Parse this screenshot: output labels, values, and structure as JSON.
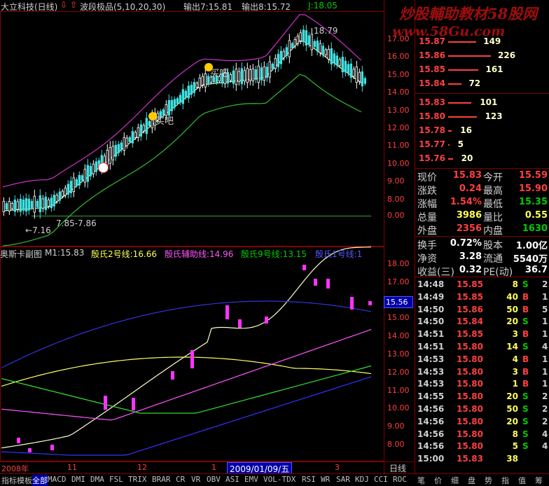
{
  "header": {
    "title": "大立科技(日线)",
    "arrow_label": "波段极品(5,10,20,30)",
    "out7": "输出7:15.81",
    "out8": "输出8:15.72",
    "jval": "J:18.05"
  },
  "watermark": {
    "brand": "炒股輔助教材58股网",
    "url": "www.58Gu.com"
  },
  "main_chart": {
    "price_ticks": [
      "17.00",
      "16.00",
      "15.00",
      "14.00",
      "13.00",
      "12.00",
      "11.00",
      "10.00",
      "9.00",
      "8.00"
    ],
    "annot_high": "18.79",
    "annot_low": "7.16",
    "annot_range": "7.85-7.86",
    "buy_label": "买吧",
    "zero_tick": "0.00"
  },
  "sub_chart": {
    "title": "奥斯卡副图",
    "m1": "M1:15.83",
    "l2": "殷氏2号线:16.66",
    "aux": "殷氏辅助线:14.96",
    "l9": "殷氏9号线:13.15",
    "l10": "殷氏1号线:1",
    "ticks": [
      "18.00",
      "17.00",
      "16.00",
      "15.00",
      "14.00",
      "13.00",
      "12.00",
      "11.00",
      "10.00",
      "9.00",
      "8.00"
    ],
    "current": "15.56"
  },
  "xaxis": {
    "labels": [
      "2008年",
      "11",
      "12",
      "1",
      "3"
    ],
    "date_box": "2009/01/09/五",
    "period": "日线"
  },
  "order_book": {
    "asks": [
      {
        "price": "15.87",
        "vol": "149"
      },
      {
        "price": "15.86",
        "vol": "226"
      },
      {
        "price": "15.85",
        "vol": "161"
      },
      {
        "price": "15.84",
        "vol": "72"
      }
    ],
    "bids": [
      {
        "price": "15.83",
        "vol": "101"
      },
      {
        "price": "15.80",
        "vol": "123"
      },
      {
        "price": "15.78",
        "vol": "16"
      },
      {
        "price": "15.77",
        "vol": "5"
      },
      {
        "price": "15.76",
        "vol": "20"
      }
    ]
  },
  "quote": {
    "rows": [
      {
        "l1": "现价",
        "v1": "15.83",
        "c1": "#ff4040",
        "l2": "今开",
        "v2": "15.59",
        "c2": "#ff4040"
      },
      {
        "l1": "涨跌",
        "v1": "0.24",
        "c1": "#ff4040",
        "l2": "最高",
        "v2": "15.90",
        "c2": "#ff4040"
      },
      {
        "l1": "涨幅",
        "v1": "1.54%",
        "c1": "#ff4040",
        "l2": "最低",
        "v2": "15.35",
        "c2": "#00cc00"
      },
      {
        "l1": "总量",
        "v1": "3986",
        "c1": "#ffff55",
        "l2": "量比",
        "v2": "0.55",
        "c2": "#ffff55"
      },
      {
        "l1": "外盘",
        "v1": "2356",
        "c1": "#ff4040",
        "l2": "内盘",
        "v2": "1630",
        "c2": "#00cc00"
      }
    ],
    "rows2": [
      {
        "l1": "换手",
        "v1": "0.72%",
        "l2": "股本",
        "v2": "1.00亿"
      },
      {
        "l1": "净资",
        "v1": "3.28",
        "l2": "流通",
        "v2": "5540万"
      },
      {
        "l1": "收益(三)",
        "v1": "0.32",
        "l2": "PE(动)",
        "v2": "36.7"
      }
    ]
  },
  "ticks_table": [
    {
      "t": "14:48",
      "p": "15.85",
      "v": "8",
      "s": "S",
      "n": "2"
    },
    {
      "t": "14:49",
      "p": "15.85",
      "v": "40",
      "s": "B",
      "n": "1"
    },
    {
      "t": "14:50",
      "p": "15.86",
      "v": "50",
      "s": "B",
      "n": "5"
    },
    {
      "t": "14:50",
      "p": "15.84",
      "v": "20",
      "s": "S",
      "n": "1"
    },
    {
      "t": "14:51",
      "p": "15.85",
      "v": "3",
      "s": "B",
      "n": "1"
    },
    {
      "t": "14:51",
      "p": "15.80",
      "v": "14",
      "s": "S",
      "n": "4"
    },
    {
      "t": "14:53",
      "p": "15.80",
      "v": "4",
      "s": "B",
      "n": "1"
    },
    {
      "t": "14:53",
      "p": "15.80",
      "v": "3",
      "s": "B",
      "n": "1"
    },
    {
      "t": "14:53",
      "p": "15.80",
      "v": "1",
      "s": "B",
      "n": "1"
    },
    {
      "t": "14:55",
      "p": "15.80",
      "v": "20",
      "s": "S",
      "n": "2"
    },
    {
      "t": "14:56",
      "p": "15.80",
      "v": "50",
      "s": "S",
      "n": "2"
    },
    {
      "t": "14:56",
      "p": "15.80",
      "v": "20",
      "s": "S",
      "n": "2"
    },
    {
      "t": "14:56",
      "p": "15.80",
      "v": "8",
      "s": "S",
      "n": "4"
    },
    {
      "t": "14:56",
      "p": "15.80",
      "v": "5",
      "s": "S",
      "n": "4"
    },
    {
      "t": "15:00",
      "p": "15.83",
      "v": "38",
      "s": "",
      "n": ""
    }
  ],
  "bottom_tabs": [
    "指标",
    "模板",
    "全部",
    "MACD",
    "DMI",
    "DMA",
    "FSL",
    "TRIX",
    "BRAR",
    "CR",
    "VR",
    "OBV",
    "ASI",
    "EMV",
    "VOL-TDX",
    "RSI",
    "WR",
    "SAR",
    "KDJ",
    "CCI",
    "ROC"
  ],
  "right_tabs": [
    "笔",
    "价",
    "细",
    "盘",
    "势",
    "指",
    "值",
    "筹"
  ]
}
